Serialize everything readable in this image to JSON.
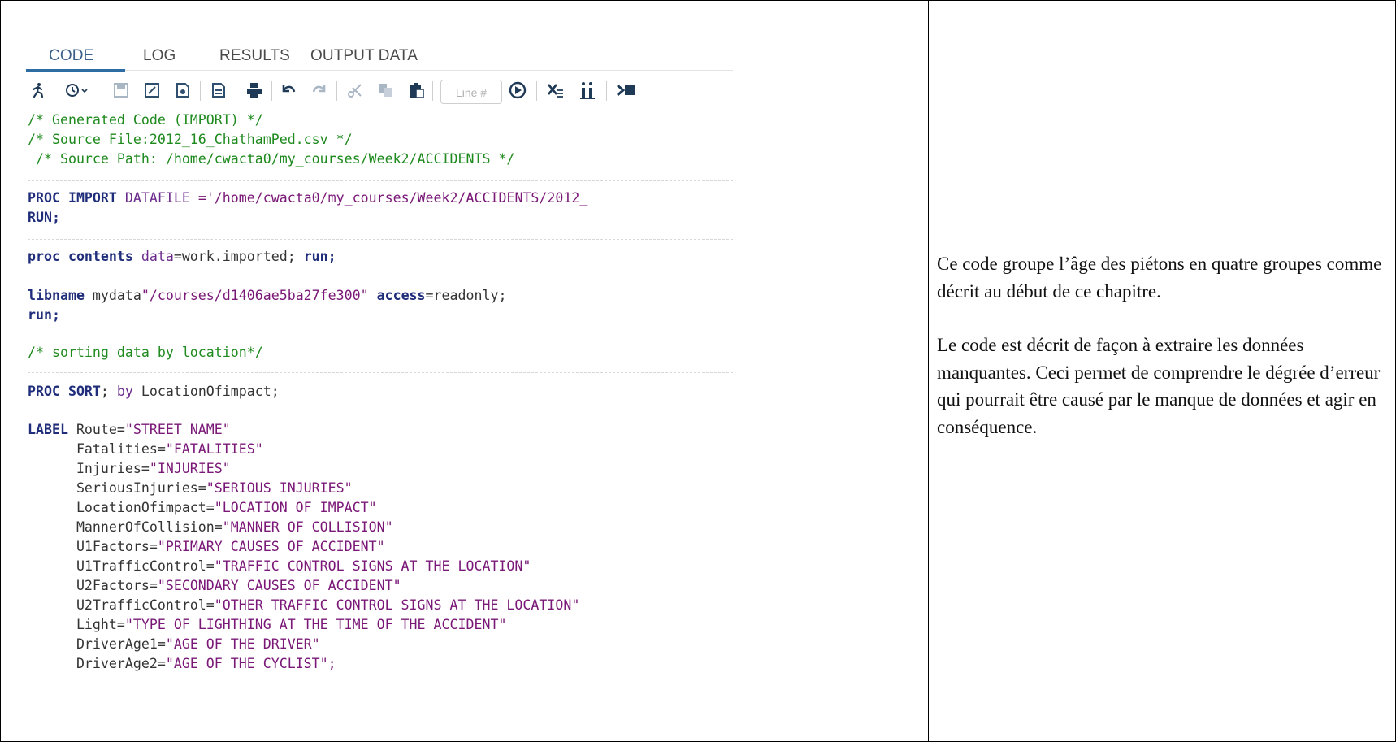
{
  "tabs": [
    "CODE",
    "LOG",
    "RESULTS",
    "OUTPUT DATA"
  ],
  "toolbar": {
    "icons": [
      "run-icon",
      "history-icon",
      "save-icon",
      "save-as-icon",
      "save-program-icon",
      "export-icon",
      "print-icon",
      "undo-icon",
      "redo-icon",
      "cut-icon",
      "copy-icon",
      "paste-icon",
      "go-to-line-icon",
      "clear-icon",
      "format-code-icon",
      "maximize-icon"
    ],
    "line_placeholder": "Line #"
  },
  "code": {
    "comment1": "/* Generated Code (IMPORT) */",
    "comment2": "/* Source File:2012_16_ChathamPed.csv */",
    "comment3": " /* Source Path: /home/cwacta0/my_courses/Week2/ACCIDENTS */",
    "import_kw": "PROC IMPORT",
    "import_attr": " DATAFILE",
    "import_rest": " ='/home/cwacta0/my_courses/Week2/ACCIDENTS/2012_",
    "run1": "RUN;",
    "contents_kw": "proc contents",
    "contents_data": " data",
    "contents_val": "=work.imported; ",
    "contents_run": "run;",
    "libname_kw": "libname",
    "libname_name": " mydata",
    "libname_path": "\"/courses/d1406ae5ba27fe300\"",
    "libname_access": " access",
    "libname_val": "=readonly;",
    "run2": "run;",
    "comment4": "/* sorting data by location*/",
    "sort_kw": "PROC SORT",
    "sort_semi": "; ",
    "sort_by": "by",
    "sort_var": " LocationOfimpact;",
    "label_kw": "LABEL",
    "labels": [
      {
        "var": " Route=",
        "text": "\"STREET NAME\""
      },
      {
        "var": "      Fatalities=",
        "text": "\"FATALITIES\""
      },
      {
        "var": "      Injuries=",
        "text": "\"INJURIES\""
      },
      {
        "var": "      SeriousInjuries=",
        "text": "\"SERIOUS INJURIES\""
      },
      {
        "var": "      LocationOfimpact=",
        "text": "\"LOCATION OF IMPACT\""
      },
      {
        "var": "      MannerOfCollision=",
        "text": "\"MANNER OF COLLISION\""
      },
      {
        "var": "      U1Factors=",
        "text": "\"PRIMARY CAUSES OF ACCIDENT\""
      },
      {
        "var": "      U1TrafficControl=",
        "text": "\"TRAFFIC CONTROL SIGNS AT THE LOCATION\""
      },
      {
        "var": "      U2Factors=",
        "text": "\"SECONDARY CAUSES OF ACCIDENT\""
      },
      {
        "var": "      U2TrafficControl=",
        "text": "\"OTHER TRAFFIC CONTROL SIGNS AT THE LOCATION\""
      },
      {
        "var": "      Light=",
        "text": "\"TYPE OF LIGHTHING AT THE TIME OF THE ACCIDENT\""
      },
      {
        "var": "      DriverAge1=",
        "text": "\"AGE OF THE DRIVER\""
      },
      {
        "var": "      DriverAge2=",
        "text": "\"AGE OF THE CYCLIST\";"
      }
    ]
  },
  "notes": {
    "paragraph1": "Ce code groupe l’âge des piétons en quatre groupes comme décrit au début de ce chapitre.",
    "paragraph2": "Le code est décrit de façon à extraire les données manquantes. Ceci permet de comprendre le dégrée d’erreur qui pourrait être causé par le manque de données et agir en conséquence."
  }
}
